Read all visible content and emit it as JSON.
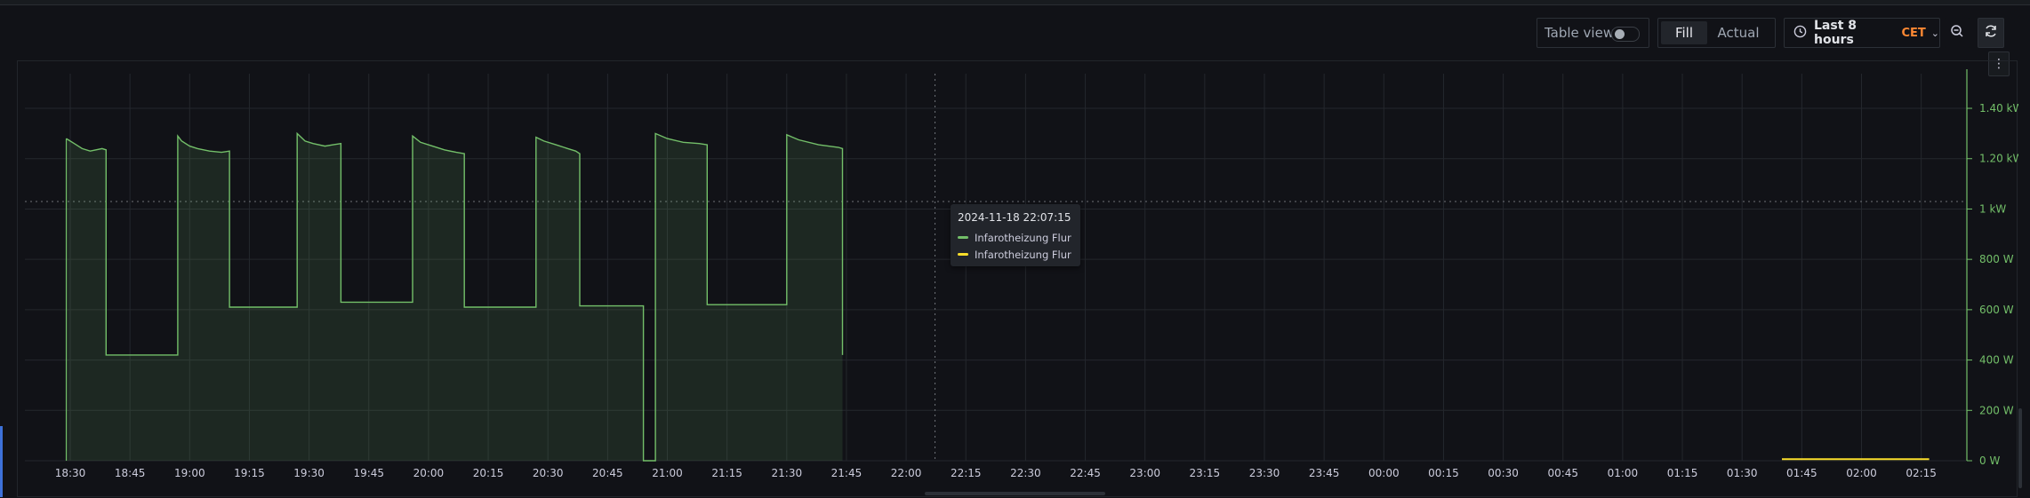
{
  "toolbar": {
    "table_view_label": "Table view",
    "table_view_on": false,
    "fill_label": "Fill",
    "actual_label": "Actual",
    "selected_mode": "Fill",
    "time_range_label": "Last 8 hours",
    "timezone": "CET"
  },
  "tooltip": {
    "time": "2024-11-18 22:07:15",
    "entries": [
      {
        "label": "Infarotheizung Flur",
        "color": "#73bf69"
      },
      {
        "label": "Infarotheizung Flur",
        "color": "#fade2a"
      }
    ]
  },
  "colors": {
    "series_green": "#73bf69",
    "series_yellow": "#fade2a",
    "background": "#111217",
    "threshold_line": "#6e7177"
  },
  "chart_data": {
    "type": "area",
    "x_tick_labels": [
      "18:30",
      "18:45",
      "19:00",
      "19:15",
      "19:30",
      "19:45",
      "20:00",
      "20:15",
      "20:30",
      "20:45",
      "21:00",
      "21:15",
      "21:30",
      "21:45",
      "22:00",
      "22:15",
      "22:30",
      "22:45",
      "23:00",
      "23:15",
      "23:30",
      "23:45",
      "00:00",
      "00:15",
      "00:30",
      "00:45",
      "01:00",
      "01:15",
      "01:30",
      "01:45",
      "02:00",
      "02:15"
    ],
    "y_tick_labels": [
      "0 W",
      "200 W",
      "400 W",
      "600 W",
      "800 W",
      "1 kW",
      "1.20 kW",
      "1.40 kW"
    ],
    "ylim": [
      0,
      1520
    ],
    "y_unit": "W",
    "reference_line_y": 1030,
    "crosshair_x": "22:07:15",
    "grid": true,
    "series": [
      {
        "name": "Infarotheizung Flur",
        "color": "#73bf69",
        "fill": true,
        "points": [
          [
            "18:29",
            1280
          ],
          [
            "18:30",
            1270
          ],
          [
            "18:31",
            1260
          ],
          [
            "18:33",
            1240
          ],
          [
            "18:35",
            1230
          ],
          [
            "18:38",
            1240
          ],
          [
            "18:39",
            1235
          ],
          [
            "18:39",
            420
          ],
          [
            "18:57",
            420
          ],
          [
            "18:57",
            1290
          ],
          [
            "18:58",
            1270
          ],
          [
            "19:00",
            1250
          ],
          [
            "19:02",
            1240
          ],
          [
            "19:05",
            1230
          ],
          [
            "19:08",
            1225
          ],
          [
            "19:10",
            1230
          ],
          [
            "19:10",
            610
          ],
          [
            "19:27",
            610
          ],
          [
            "19:27",
            1300
          ],
          [
            "19:29",
            1270
          ],
          [
            "19:31",
            1260
          ],
          [
            "19:34",
            1250
          ],
          [
            "19:36",
            1255
          ],
          [
            "19:38",
            1260
          ],
          [
            "19:38",
            630
          ],
          [
            "19:56",
            630
          ],
          [
            "19:56",
            1290
          ],
          [
            "19:58",
            1265
          ],
          [
            "20:01",
            1250
          ],
          [
            "20:04",
            1235
          ],
          [
            "20:07",
            1225
          ],
          [
            "20:09",
            1220
          ],
          [
            "20:09",
            610
          ],
          [
            "20:27",
            610
          ],
          [
            "20:27",
            1285
          ],
          [
            "20:29",
            1270
          ],
          [
            "20:32",
            1255
          ],
          [
            "20:35",
            1240
          ],
          [
            "20:37",
            1230
          ],
          [
            "20:38",
            1220
          ],
          [
            "20:38",
            615
          ],
          [
            "20:54",
            615
          ],
          [
            "20:54",
            0
          ],
          [
            "20:57",
            0
          ],
          [
            "20:57",
            1300
          ],
          [
            "21:00",
            1280
          ],
          [
            "21:04",
            1265
          ],
          [
            "21:08",
            1260
          ],
          [
            "21:10",
            1255
          ],
          [
            "21:10",
            620
          ],
          [
            "21:30",
            620
          ],
          [
            "21:30",
            1295
          ],
          [
            "21:33",
            1275
          ],
          [
            "21:38",
            1255
          ],
          [
            "21:43",
            1245
          ],
          [
            "21:44",
            1240
          ],
          [
            "21:44",
            420
          ]
        ]
      },
      {
        "name": "Infarotheizung Flur",
        "color": "#fade2a",
        "fill": false,
        "points": [
          [
            "01:40",
            6
          ],
          [
            "02:17",
            6
          ]
        ]
      }
    ]
  }
}
